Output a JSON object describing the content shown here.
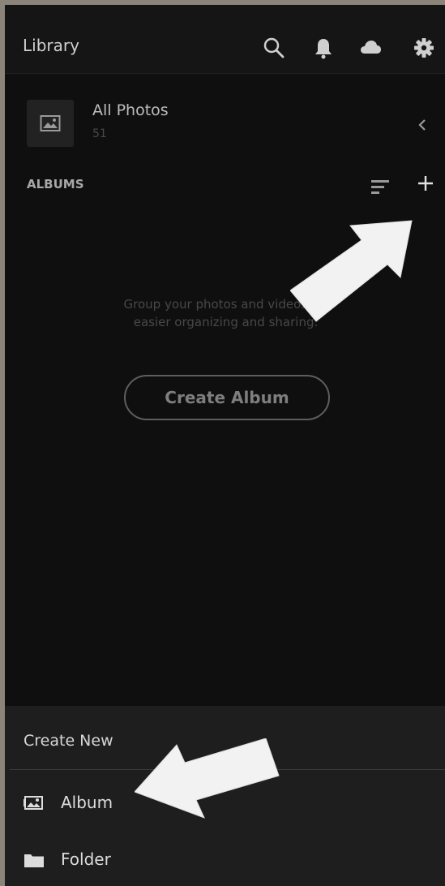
{
  "header": {
    "title": "Library",
    "icons": [
      "search-icon",
      "bell-icon",
      "cloud-icon",
      "gear-icon"
    ]
  },
  "all_photos": {
    "title": "All Photos",
    "count": "51"
  },
  "albums": {
    "label": "ALBUMS",
    "empty_line1": "Group your photos and videos for",
    "empty_line2": "easier organizing and sharing.",
    "create_button": "Create Album"
  },
  "create_new": {
    "title": "Create New",
    "items": [
      {
        "label": "Album",
        "icon": "album-icon"
      },
      {
        "label": "Folder",
        "icon": "folder-icon"
      }
    ]
  },
  "colors": {
    "background": "#0f0f0f",
    "frame": "#8b8478",
    "sheet": "#1e1e1e",
    "annotation_arrow": "#f2f2f2"
  }
}
